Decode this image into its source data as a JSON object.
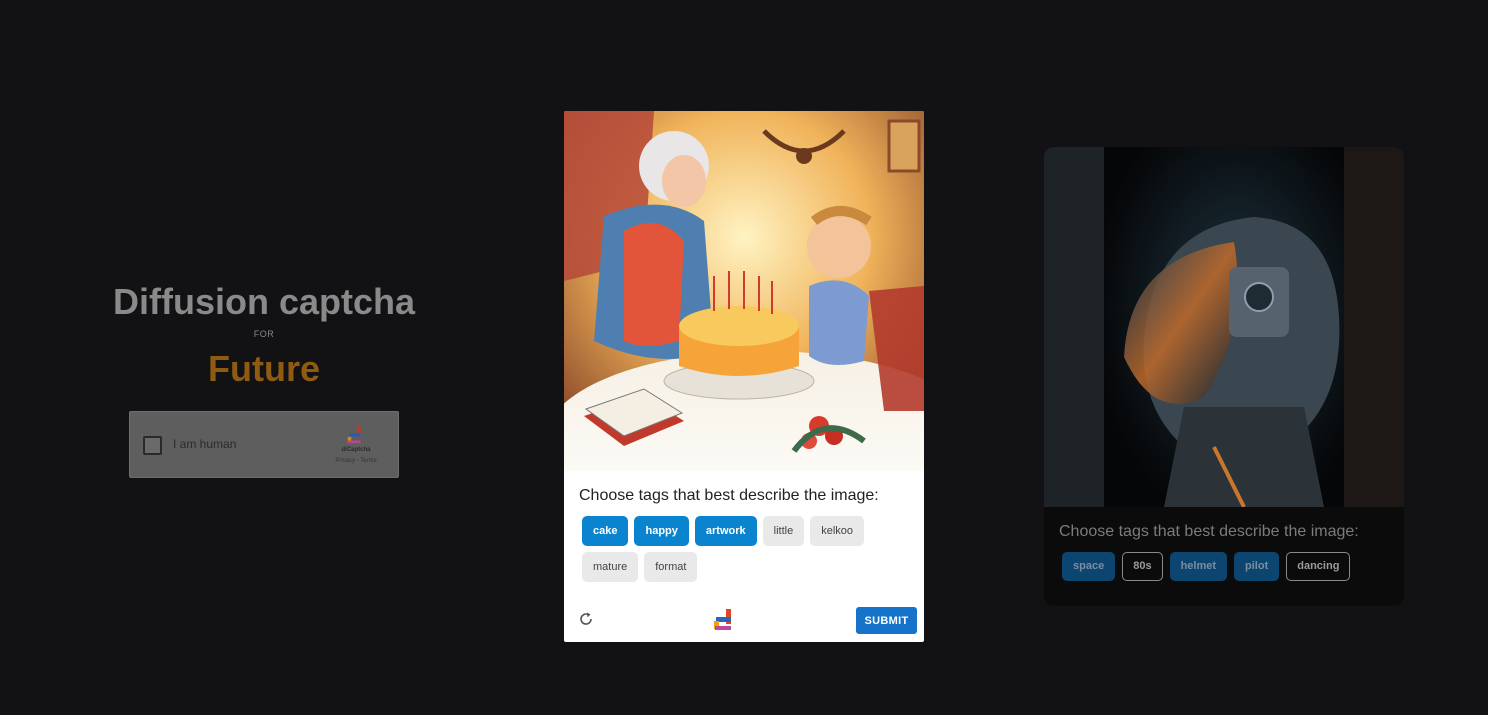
{
  "hero": {
    "title": "Diffusion captcha",
    "for": "FOR",
    "future": "Future"
  },
  "widget": {
    "checkbox_label": "I am human",
    "brand": "diCaptcha",
    "links": "Privacy - Terms"
  },
  "main_card": {
    "prompt": "Choose tags that best describe the image:",
    "tags": [
      {
        "label": "cake",
        "selected": true
      },
      {
        "label": "happy",
        "selected": true
      },
      {
        "label": "artwork",
        "selected": true
      },
      {
        "label": "little",
        "selected": false
      },
      {
        "label": "kelkoo",
        "selected": false
      },
      {
        "label": "mature",
        "selected": false
      },
      {
        "label": "format",
        "selected": false
      }
    ],
    "submit_label": "SUBMIT"
  },
  "side_card": {
    "prompt": "Choose tags that best describe the image:",
    "tags": [
      {
        "label": "space",
        "selected": true
      },
      {
        "label": "80s",
        "selected": false
      },
      {
        "label": "helmet",
        "selected": true
      },
      {
        "label": "pilot",
        "selected": true
      },
      {
        "label": "dancing",
        "selected": false
      }
    ]
  },
  "colors": {
    "background": "#121214",
    "accent": "#0a84cf",
    "submit": "#1573c9",
    "future": "#8f5b10"
  },
  "icons": [
    "checkbox-icon",
    "dicaptcha-logo-icon",
    "refresh-icon"
  ]
}
